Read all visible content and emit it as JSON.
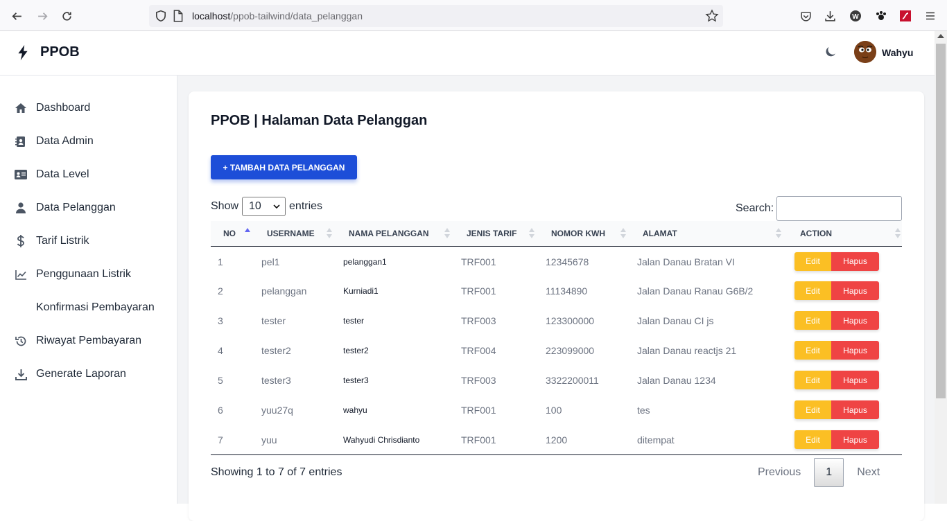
{
  "browser": {
    "url_host": "localhost",
    "url_path": "/ppob-tailwind/data_pelanggan"
  },
  "header": {
    "brand": "PPOB",
    "username": "Wahyu"
  },
  "sidebar": {
    "items": [
      {
        "label": "Dashboard",
        "icon": "home-icon"
      },
      {
        "label": "Data Admin",
        "icon": "contact-book-icon"
      },
      {
        "label": "Data Level",
        "icon": "id-card-icon"
      },
      {
        "label": "Data Pelanggan",
        "icon": "user-icon"
      },
      {
        "label": "Tarif Listrik",
        "icon": "dollar-icon"
      },
      {
        "label": "Penggunaan Listrik",
        "icon": "line-chart-icon"
      },
      {
        "label": "Konfirmasi Pembayaran",
        "icon": ""
      },
      {
        "label": "Riwayat Pembayaran",
        "icon": "history-icon"
      },
      {
        "label": "Generate Laporan",
        "icon": "download-icon"
      }
    ]
  },
  "main": {
    "title": "PPOB | Halaman Data Pelanggan",
    "add_button": "+ TAMBAH DATA PELANGGAN",
    "show_label": "Show",
    "entries_label": "entries",
    "page_length": "10",
    "search_label": "Search:",
    "columns": [
      "NO",
      "USERNAME",
      "NAMA PELANGGAN",
      "JENIS TARIF",
      "NOMOR KWH",
      "ALAMAT",
      "ACTION"
    ],
    "rows": [
      {
        "no": "1",
        "username": "pel1",
        "nama": "pelanggan1",
        "tarif": "TRF001",
        "kwh": "12345678",
        "alamat": "Jalan Danau Bratan VI"
      },
      {
        "no": "2",
        "username": "pelanggan",
        "nama": "Kurniadi1",
        "tarif": "TRF001",
        "kwh": "11134890",
        "alamat": "Jalan Danau Ranau G6B/2"
      },
      {
        "no": "3",
        "username": "tester",
        "nama": "tester",
        "tarif": "TRF003",
        "kwh": "123300000",
        "alamat": "Jalan Danau CI js"
      },
      {
        "no": "4",
        "username": "tester2",
        "nama": "tester2",
        "tarif": "TRF004",
        "kwh": "223099000",
        "alamat": "Jalan Danau reactjs 21"
      },
      {
        "no": "5",
        "username": "tester3",
        "nama": "tester3",
        "tarif": "TRF003",
        "kwh": "3322200011",
        "alamat": "Jalan Danau 1234"
      },
      {
        "no": "6",
        "username": "yuu27q",
        "nama": "wahyu",
        "tarif": "TRF001",
        "kwh": "100",
        "alamat": "tes"
      },
      {
        "no": "7",
        "username": "yuu",
        "nama": "Wahyudi Chrisdianto",
        "tarif": "TRF001",
        "kwh": "1200",
        "alamat": "ditempat"
      }
    ],
    "edit_label": "Edit",
    "hapus_label": "Hapus",
    "info": "Showing 1 to 7 of 7 entries",
    "pager": {
      "previous": "Previous",
      "current": "1",
      "next": "Next"
    }
  },
  "colors": {
    "primary": "#1d4ed8",
    "edit": "#fbbf24",
    "delete": "#ef4444"
  }
}
